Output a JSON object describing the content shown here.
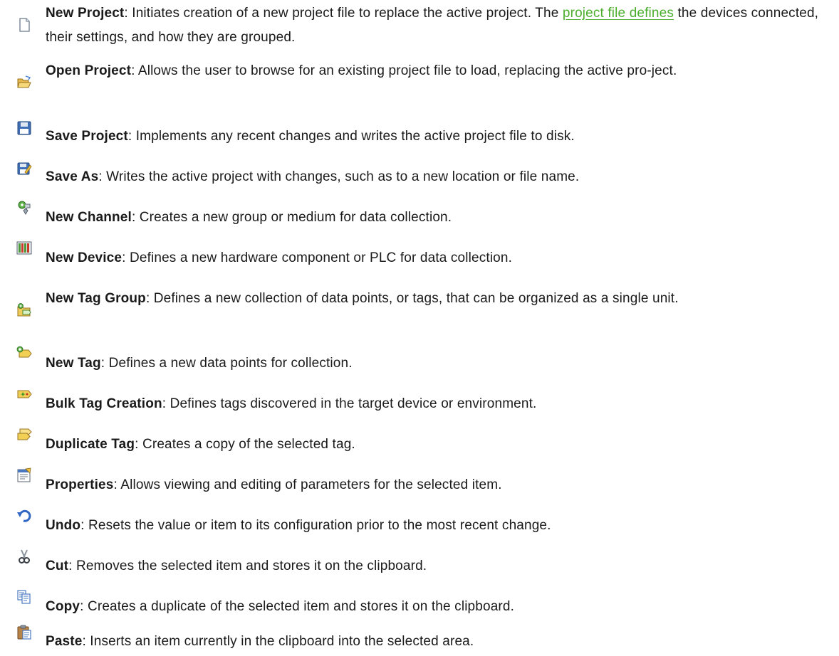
{
  "toolbar_items": [
    {
      "icon": "new-project-icon",
      "term": "New Project",
      "desc_before": ": Initiates creation of a new project file to replace the active project. The ",
      "link": "project file defines",
      "desc_after": " the devices connected, their settings, and how they are grouped."
    },
    {
      "icon": "open-folder-icon",
      "term": "Open Project",
      "desc": ": Allows the user to browse for an existing project file to load, replacing the active pro-ject."
    },
    {
      "icon": "save-disk-icon",
      "term": "Save Project",
      "desc": ": Implements any recent changes and writes the active project file to disk."
    },
    {
      "icon": "save-as-icon",
      "term": "Save As",
      "desc": ": Writes the active project with changes, such as to a new location or file name."
    },
    {
      "icon": "new-channel-icon",
      "term": "New Channel",
      "desc": ": Creates a new group or medium for data collection."
    },
    {
      "icon": "new-device-icon",
      "term": "New Device",
      "desc": ": Defines a new hardware component or PLC for data collection."
    },
    {
      "icon": "new-tag-group-icon",
      "term": "New Tag Group",
      "desc": ": Defines a new collection of data points, or tags, that can be organized as a single unit."
    },
    {
      "icon": "new-tag-icon",
      "term": "New Tag",
      "desc": ": Defines a new data points for collection."
    },
    {
      "icon": "bulk-tag-creation-icon",
      "term": "Bulk Tag Creation",
      "desc": ": Defines tags discovered in the target device or environment."
    },
    {
      "icon": "duplicate-tag-icon",
      "term": "Duplicate Tag",
      "desc": ": Creates a copy of the selected tag."
    },
    {
      "icon": "properties-icon",
      "term": "Properties",
      "desc": ": Allows viewing and editing of parameters for the selected item."
    },
    {
      "icon": "undo-icon",
      "term": "Undo",
      "desc": ": Resets the value or item to its configuration prior to the most recent change."
    },
    {
      "icon": "cut-scissors-icon",
      "term": "Cut",
      "desc": ": Removes the selected item and stores it on the clipboard."
    },
    {
      "icon": "copy-icon",
      "term": "Copy",
      "desc": ": Creates a duplicate of the selected item and stores it on the clipboard."
    },
    {
      "icon": "paste-clipboard-icon",
      "term": "Paste",
      "desc": ": Inserts an item currently in the clipboard into the selected area."
    }
  ]
}
